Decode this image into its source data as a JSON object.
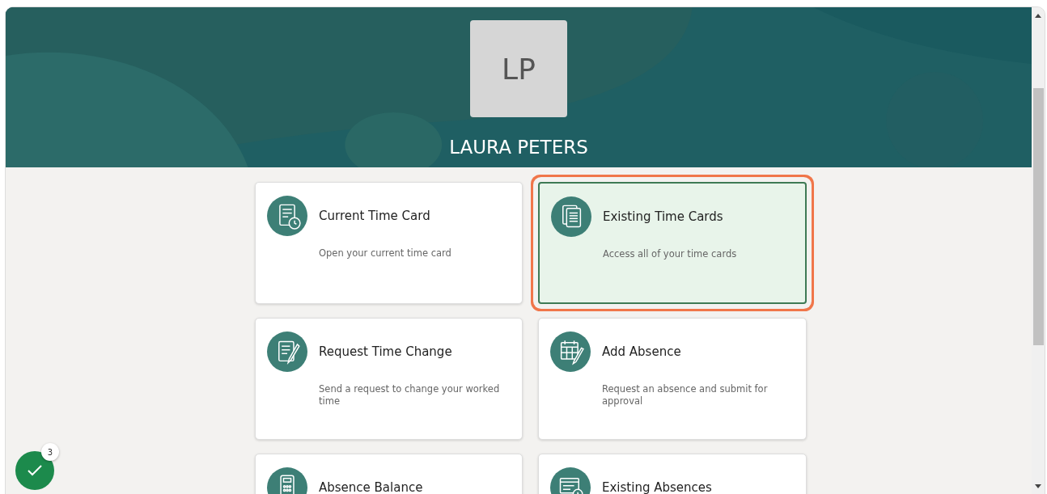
{
  "profile": {
    "initials": "LP",
    "name": "LAURA PETERS"
  },
  "cards": [
    {
      "kind": "time-card",
      "title": "Current Time Card",
      "description": "Open your current time card",
      "selected": false
    },
    {
      "kind": "stack",
      "title": "Existing Time Cards",
      "description": "Access all of your time cards",
      "selected": true
    },
    {
      "kind": "edit",
      "title": "Request Time Change",
      "description": "Send a request to change your worked time",
      "selected": false
    },
    {
      "kind": "calendar",
      "title": "Add Absence",
      "description": "Request an absence and submit for approval",
      "selected": false
    },
    {
      "kind": "calculator",
      "title": "Absence Balance",
      "selected": false
    },
    {
      "kind": "list-clock",
      "title": "Existing Absences",
      "selected": false
    }
  ],
  "task_button": {
    "badge": "3"
  }
}
